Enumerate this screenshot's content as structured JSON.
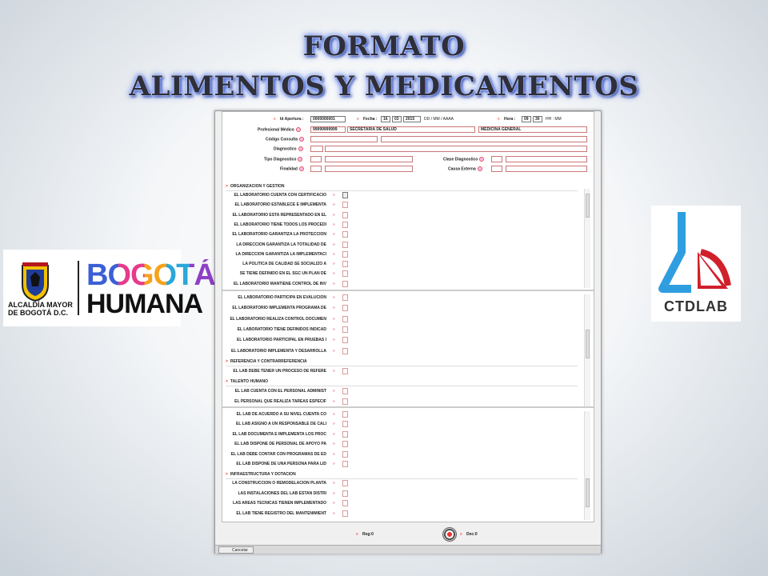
{
  "title": {
    "line1": "FORMATO",
    "line2": "ALIMENTOS Y MEDICAMENTOS"
  },
  "logos": {
    "left": {
      "org_line1": "ALCALDÍA MAYOR",
      "org_line2": "DE BOGOTÁ D.C.",
      "brand1": "BOGOTÁ",
      "brand2": "HUMANA"
    },
    "right": {
      "brand": "CTDLAB"
    }
  },
  "form": {
    "header": {
      "id_apertura_label": "Id Apertura :",
      "id_apertura_value": "0000000001",
      "fecha_label": "Fecha :",
      "fecha_dd": "16",
      "fecha_mm": "03",
      "fecha_aaaa": "2015",
      "fecha_format": "DD / MM / AAAA",
      "hora_label": "Hora :",
      "hora_hh": "09",
      "hora_mm": "30",
      "hora_format": "HH : MM",
      "profesional_label": "Profesional Médico",
      "profesional_id": "99999999999",
      "profesional_entity": "SECRETARIA DE SALUD",
      "profesional_specialty": "MEDICINA GENERAL",
      "codigo_consulta_label": "Código Consulta",
      "diagnostico_label": "Diagnostico",
      "tipo_diagnostico_label": "Tipo Diagnostico",
      "clase_diagnostico_label": "Clase Diagnostico",
      "finalidad_label": "Finalidad",
      "causa_externa_label": "Causa Externa"
    },
    "panels": [
      {
        "section": "ORGANIZACION Y GESTION",
        "items": [
          "EL LABORATORIO CUENTA CON CERTIFICACIO",
          "EL LABORATORIO ESTABLECE E IMPLEMENTA",
          "EL LABORATORIO ESTA REPRESENTADO EN EL",
          "EL LABORATORIO TIENE TODOS LOS PROCEDI",
          "EL LABORATORIO GARANTIZA LA PROTECCION",
          "LA DIRECCION GARANTIZA LA TOTALIDAD DE",
          "LA DIRECCION GARANTIZA LA IMPLEMENTACI",
          "LA POLITICA DE CALIDAD SE SOCIALIZO A",
          "SE TIENE DEFINIDO EN EL SGC UN PLAN DE",
          "EL LABORATORIO MANTIENE CONTROL DE INV"
        ]
      },
      {
        "section": "",
        "items": [
          "EL LABORATORIO PARTICIPA EN EVALUCION",
          "EL LABORATORIO IMPLEMENTA PROGRAMA DE",
          "EL LABORATORIO REALIZA CONTROL DOCUMEN",
          "EL LABORATORIO TIENE DEFINIDOS INDICAD",
          "EL LABORATORIO PARTICIPAL EN PRUEBAS I",
          "EL LABORATORIO IMPLEMENTA Y DESARROLLA"
        ],
        "section2": "REFERENCIA Y CONTRARREFERENCIA",
        "items2": [
          "EL LAB DEBE TENER UN PROCESO DE REFERE"
        ],
        "section3": "TALENTO HUMANO",
        "items3": [
          "EL LAB CUENTA CON EL PERSONAL ADMINIST",
          "EL PERSONAL QUE REALIZA TAREAS ESPECIF"
        ]
      },
      {
        "section": "",
        "items": [
          "EL LAB DE ACUERDO A SU NIVEL CUENTA CO",
          "EL LAB ASIGNO A UN RESPONSABLE DE CALI",
          "EL LAB DOCUMENTA E IMPLEMENTA LOS PROC",
          "EL LAB DISPONE DE PERSONAL DE APOYO PA",
          "EL LAB DEBE CONTAR CON PROGRAMAS DE ED",
          "EL LAB DISPONE DE UNA PERSONA PARA LID"
        ],
        "section2": "INFRAESTRUCTURA Y DOTACION",
        "items2": [
          "LA CONSTRUCCION O REMODELACION PLANTA",
          "LAS INSTALACIONES DEL LAB ESTAN DISTRI",
          "LAS AREAS TECNICAS TIENEN IMPLEMENTADO",
          "EL LAB TIENE REGISTRO DEL MANTENIMIENT"
        ]
      }
    ],
    "footer": {
      "reg_label": "Reg:0",
      "dec_label": "Dec:0"
    },
    "taskbar": {
      "cancel_label": "Cancelar"
    }
  },
  "colors": {
    "title_glow": "#3f66e6",
    "required": "#dd5555",
    "bogota_b": "#3b5fd6",
    "bogota_o": "#e63a8d",
    "ctdlab_blue": "#2f9ee0",
    "ctdlab_red": "#d0202a"
  }
}
